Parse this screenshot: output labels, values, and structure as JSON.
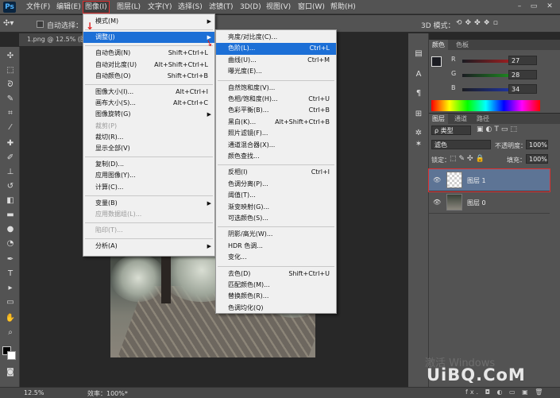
{
  "app": {
    "logo": "Ps"
  },
  "menubar": [
    "文件(F)",
    "编辑(E)",
    "图像(I)",
    "图层(L)",
    "文字(Y)",
    "选择(S)",
    "滤镜(T)",
    "3D(D)",
    "视图(V)",
    "窗口(W)",
    "帮助(H)"
  ],
  "window_controls": [
    "–",
    "▭",
    "✕"
  ],
  "options": {
    "auto_select": "自动选择：",
    "mode_3d": "3D 模式："
  },
  "document": {
    "tab": "1.png @ 12.5% (图"
  },
  "status": {
    "zoom": "12.5%",
    "efficiency": "效率：100%*"
  },
  "image_menu": [
    {
      "label": "模式(M)",
      "sc": "",
      "sub": true
    },
    {
      "sep": true
    },
    {
      "label": "调整(J)",
      "sc": "",
      "sub": true,
      "highlight": true
    },
    {
      "sep": true
    },
    {
      "label": "自动色调(N)",
      "sc": "Shift+Ctrl+L"
    },
    {
      "label": "自动对比度(U)",
      "sc": "Alt+Shift+Ctrl+L"
    },
    {
      "label": "自动颜色(O)",
      "sc": "Shift+Ctrl+B"
    },
    {
      "sep": true
    },
    {
      "label": "图像大小(I)...",
      "sc": "Alt+Ctrl+I"
    },
    {
      "label": "画布大小(S)...",
      "sc": "Alt+Ctrl+C"
    },
    {
      "label": "图像旋转(G)",
      "sc": "",
      "sub": true
    },
    {
      "label": "裁剪(P)",
      "sc": "",
      "disabled": true
    },
    {
      "label": "裁切(R)...",
      "sc": ""
    },
    {
      "label": "显示全部(V)",
      "sc": ""
    },
    {
      "sep": true
    },
    {
      "label": "复制(D)...",
      "sc": ""
    },
    {
      "label": "应用图像(Y)...",
      "sc": ""
    },
    {
      "label": "计算(C)...",
      "sc": ""
    },
    {
      "sep": true
    },
    {
      "label": "变量(B)",
      "sc": "",
      "sub": true
    },
    {
      "label": "应用数据组(L)...",
      "sc": "",
      "disabled": true
    },
    {
      "sep": true
    },
    {
      "label": "陷印(T)...",
      "sc": "",
      "disabled": true
    },
    {
      "sep": true
    },
    {
      "label": "分析(A)",
      "sc": "",
      "sub": true
    }
  ],
  "adjust_menu": [
    {
      "label": "亮度/对比度(C)...",
      "sc": ""
    },
    {
      "label": "色阶(L)...",
      "sc": "Ctrl+L",
      "highlight": true
    },
    {
      "label": "曲线(U)...",
      "sc": "Ctrl+M"
    },
    {
      "label": "曝光度(E)...",
      "sc": ""
    },
    {
      "sep": true
    },
    {
      "label": "自然饱和度(V)...",
      "sc": ""
    },
    {
      "label": "色相/饱和度(H)...",
      "sc": "Ctrl+U"
    },
    {
      "label": "色彩平衡(B)...",
      "sc": "Ctrl+B"
    },
    {
      "label": "黑白(K)...",
      "sc": "Alt+Shift+Ctrl+B"
    },
    {
      "label": "照片滤镜(F)...",
      "sc": ""
    },
    {
      "label": "通道混合器(X)...",
      "sc": ""
    },
    {
      "label": "颜色查找...",
      "sc": ""
    },
    {
      "sep": true
    },
    {
      "label": "反相(I)",
      "sc": "Ctrl+I"
    },
    {
      "label": "色调分离(P)...",
      "sc": ""
    },
    {
      "label": "阈值(T)...",
      "sc": ""
    },
    {
      "label": "渐变映射(G)...",
      "sc": ""
    },
    {
      "label": "可选颜色(S)...",
      "sc": ""
    },
    {
      "sep": true
    },
    {
      "label": "阴影/高光(W)...",
      "sc": ""
    },
    {
      "label": "HDR 色调...",
      "sc": ""
    },
    {
      "label": "变化...",
      "sc": ""
    },
    {
      "sep": true
    },
    {
      "label": "去色(D)",
      "sc": "Shift+Ctrl+U"
    },
    {
      "label": "匹配颜色(M)...",
      "sc": ""
    },
    {
      "label": "替换颜色(R)...",
      "sc": ""
    },
    {
      "label": "色调均化(Q)",
      "sc": ""
    }
  ],
  "color_panel": {
    "tabs": [
      "颜色",
      "色板"
    ],
    "sliders": [
      {
        "label": "R",
        "value": "27",
        "color": "#e02020"
      },
      {
        "label": "G",
        "value": "28",
        "color": "#20c020"
      },
      {
        "label": "B",
        "value": "34",
        "color": "#2040e0"
      }
    ]
  },
  "layers_panel": {
    "tabs": [
      "图层",
      "通道",
      "路径"
    ],
    "kind": "ρ 类型",
    "blend": "滤色",
    "opacity_label": "不透明度：",
    "opacity": "100%",
    "lock_label": "锁定：",
    "fill_label": "填充：",
    "fill": "100%",
    "layers": [
      {
        "name": "图层 1",
        "selected": true,
        "thumb": "transparent"
      },
      {
        "name": "图层 0",
        "selected": false,
        "thumb": "photo"
      }
    ],
    "bottom_icons": "fx. ◘ ◐ ▭ ▣ 🗑"
  },
  "watermark": {
    "line1": "激活 Windows",
    "line2": "UiBQ.CoM"
  }
}
